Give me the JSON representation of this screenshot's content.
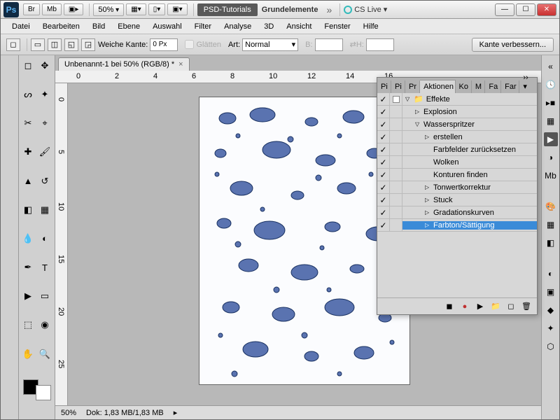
{
  "title_bar": {
    "br": "Br",
    "mb": "Mb",
    "zoom": "50%",
    "pill1": "PSD-Tutorials",
    "pill2": "Grundelemente",
    "cslive": "CS Live"
  },
  "menu": [
    "Datei",
    "Bearbeiten",
    "Bild",
    "Ebene",
    "Auswahl",
    "Filter",
    "Analyse",
    "3D",
    "Ansicht",
    "Fenster",
    "Hilfe"
  ],
  "options": {
    "soft_edge_label": "Weiche Kante:",
    "soft_edge_value": "0 Px",
    "antialias_label": "Glätten",
    "type_label": "Art:",
    "type_value": "Normal",
    "w_label": "B:",
    "h_label": "H:",
    "refine": "Kante verbessern..."
  },
  "doc_tab": "Unbenannt-1 bei 50% (RGB/8) *",
  "ruler_h": [
    "0",
    "2",
    "4",
    "6",
    "8",
    "10",
    "12",
    "14",
    "16"
  ],
  "ruler_v": [
    "0",
    "5",
    "10",
    "15",
    "20",
    "25"
  ],
  "status": {
    "zoom": "50%",
    "doc": "Dok: 1,83 MB/1,83 MB"
  },
  "panel": {
    "tabs": [
      "Pi",
      "Pi",
      "Pr",
      "Aktionen",
      "Ko",
      "M",
      "Fa",
      "Far"
    ],
    "active_tab": 3,
    "rows": [
      {
        "chk": true,
        "rec": true,
        "depth": 0,
        "arrow": "down",
        "label": "Effekte",
        "folder": true
      },
      {
        "chk": true,
        "rec": false,
        "depth": 1,
        "arrow": "right",
        "label": "Explosion"
      },
      {
        "chk": true,
        "rec": false,
        "depth": 1,
        "arrow": "down",
        "label": "Wasserspritzer"
      },
      {
        "chk": true,
        "rec": false,
        "depth": 2,
        "arrow": "right",
        "label": "erstellen"
      },
      {
        "chk": true,
        "rec": false,
        "depth": 2,
        "arrow": "",
        "label": "Farbfelder zurücksetzen"
      },
      {
        "chk": true,
        "rec": false,
        "depth": 2,
        "arrow": "",
        "label": "Wolken"
      },
      {
        "chk": true,
        "rec": false,
        "depth": 2,
        "arrow": "",
        "label": "Konturen finden"
      },
      {
        "chk": true,
        "rec": false,
        "depth": 2,
        "arrow": "right",
        "label": "Tonwertkorrektur"
      },
      {
        "chk": true,
        "rec": false,
        "depth": 2,
        "arrow": "right",
        "label": "Stuck"
      },
      {
        "chk": true,
        "rec": false,
        "depth": 2,
        "arrow": "right",
        "label": "Gradationskurven"
      },
      {
        "chk": true,
        "rec": false,
        "depth": 2,
        "arrow": "right",
        "label": "Farbton/Sättigung",
        "sel": true
      }
    ]
  }
}
